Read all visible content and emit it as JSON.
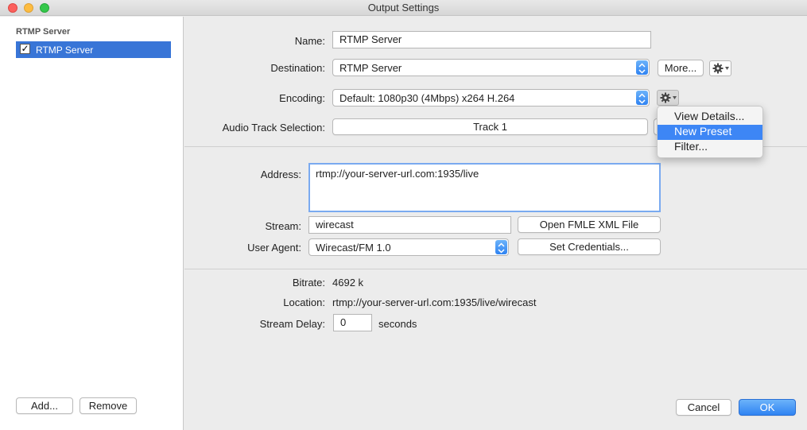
{
  "window": {
    "title": "Output Settings"
  },
  "sidebar": {
    "header": "RTMP Server",
    "items": [
      {
        "label": "RTMP Server",
        "checked": true
      }
    ],
    "add_label": "Add...",
    "remove_label": "Remove"
  },
  "output": {
    "name_label": "Name:",
    "name_value": "RTMP Server",
    "destination_label": "Destination:",
    "destination_value": "RTMP Server",
    "more_label": "More...",
    "encoding_label": "Encoding:",
    "encoding_value": "Default: 1080p30 (4Mbps) x264 H.264",
    "audio_label": "Audio Track Selection:",
    "audio_value": "Track 1"
  },
  "gear_menu": {
    "items": [
      {
        "label": "View Details...",
        "highlighted": false
      },
      {
        "label": "New Preset",
        "highlighted": true
      },
      {
        "label": "Filter...",
        "highlighted": false
      }
    ]
  },
  "server": {
    "address_label": "Address:",
    "address_value": "rtmp://your-server-url.com:1935/live",
    "stream_label": "Stream:",
    "stream_value": "wirecast",
    "fmle_label": "Open FMLE XML File",
    "agent_label": "User Agent:",
    "agent_value": "Wirecast/FM 1.0",
    "credentials_label": "Set Credentials..."
  },
  "info": {
    "bitrate_label": "Bitrate:",
    "bitrate_value": "4692 k",
    "location_label": "Location:",
    "location_value": "rtmp://your-server-url.com:1935/live/wirecast",
    "delay_label": "Stream Delay:",
    "delay_value": "0",
    "delay_unit": "seconds"
  },
  "footer": {
    "cancel_label": "Cancel",
    "ok_label": "OK"
  },
  "colors": {
    "accent": "#3875d7",
    "menu_highlight": "#3d86f5"
  }
}
